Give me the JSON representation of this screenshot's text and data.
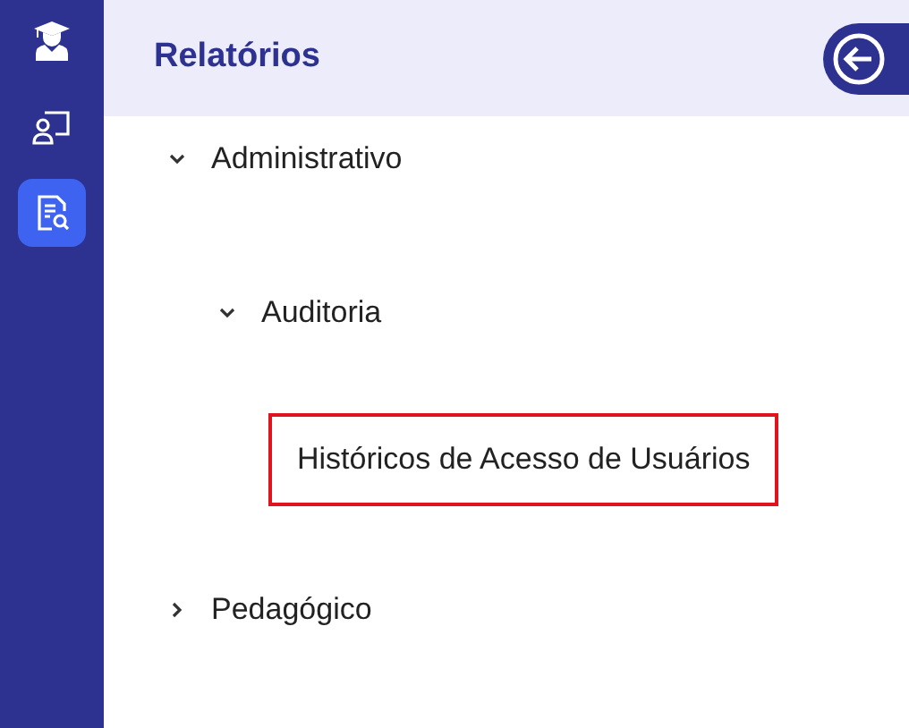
{
  "sidebar": {
    "items": [
      {
        "kind": "graduate",
        "selected": false
      },
      {
        "kind": "teacher",
        "selected": false
      },
      {
        "kind": "report",
        "selected": true
      }
    ]
  },
  "panel": {
    "title": "Relatórios"
  },
  "tree": [
    {
      "label": "Administrativo",
      "expanded": true,
      "children": [
        {
          "label": "Auditoria",
          "expanded": true,
          "children": [
            {
              "label": "Históricos de Acesso de Usuários",
              "selected": true
            }
          ]
        }
      ]
    },
    {
      "label": "Pedagógico",
      "expanded": false
    }
  ]
}
